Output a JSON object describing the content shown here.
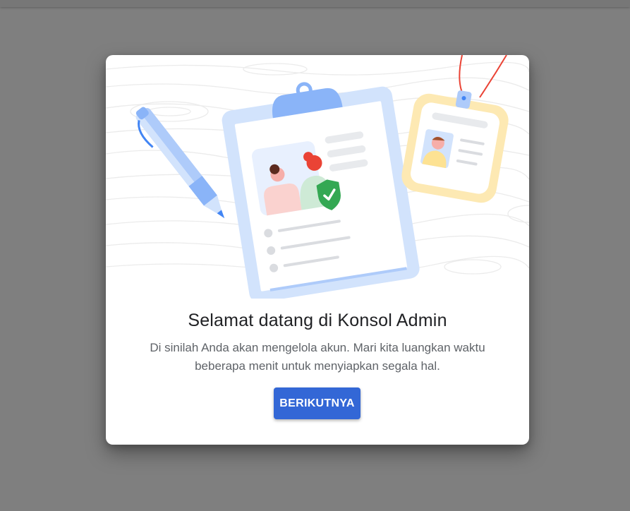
{
  "dialog": {
    "title": "Selamat datang di Konsol Admin",
    "description": "Di sinilah Anda akan mengelola akun. Mari kita luangkan waktu beberapa menit untuk menyiapkan segala hal.",
    "next_button": "BERIKUTNYA"
  },
  "illustration": {
    "icons": [
      "pen-icon",
      "clipboard-icon",
      "shield-check-icon",
      "id-badge-icon"
    ]
  },
  "colors": {
    "overlay": "#7f7f7f",
    "primary_button": "#3367d6",
    "title_text": "#202124",
    "body_text": "#5f6368",
    "check_green": "#34a853",
    "accent_red": "#ea4335",
    "badge_yellow": "#fde9b3",
    "clipboard_blue": "#d2e3fc"
  }
}
